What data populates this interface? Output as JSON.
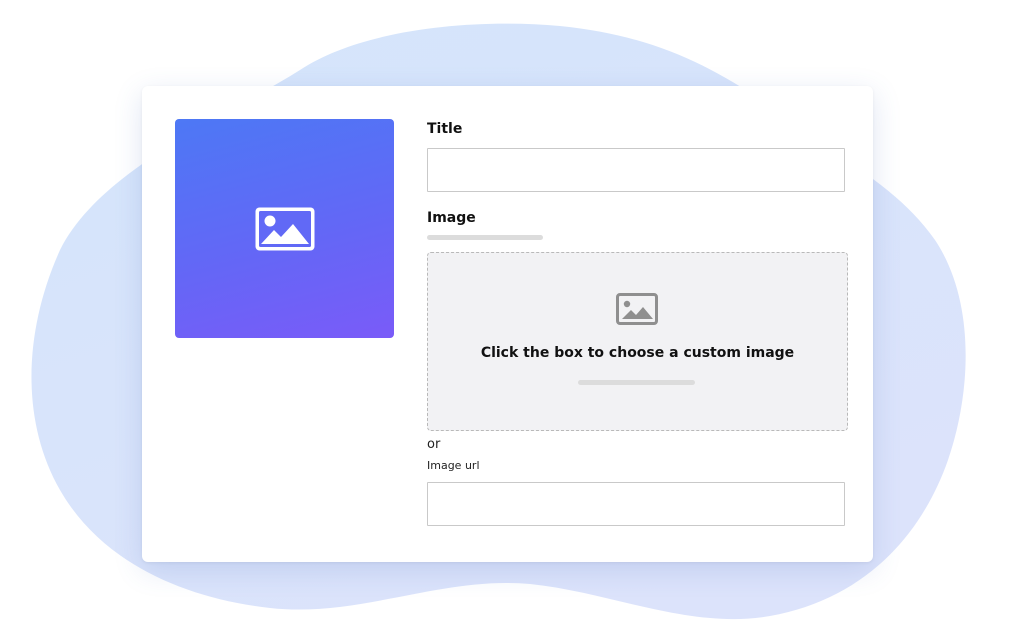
{
  "form": {
    "title_label": "Title",
    "title_value": "",
    "image_label": "Image",
    "dropzone_text": "Click the box to choose a custom image",
    "or_text": "or",
    "url_label": "Image url",
    "url_value": ""
  },
  "preview": {
    "icon": "image-icon",
    "gradient_start": "#4d78f5",
    "gradient_end": "#7a5bf8"
  },
  "dropzone": {
    "icon": "image-icon"
  },
  "colors": {
    "blob": "#d6e6fb",
    "card": "#ffffff",
    "dropzone_bg": "#f2f2f4"
  }
}
